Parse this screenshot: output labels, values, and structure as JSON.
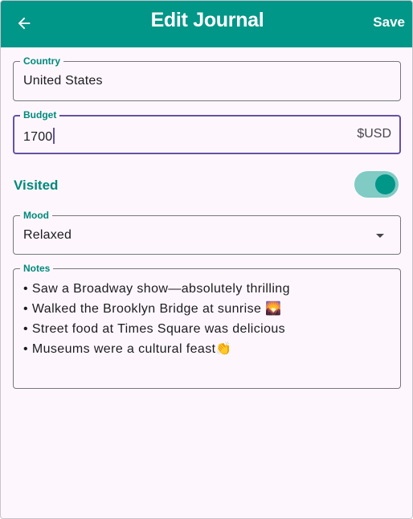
{
  "appbar": {
    "title": "Edit Journal",
    "save_label": "Save",
    "back_icon": "arrow-left-icon",
    "color": "#009688"
  },
  "form": {
    "country": {
      "label": "Country",
      "value": "United States"
    },
    "budget": {
      "label": "Budget",
      "value": "1700",
      "suffix": "$USD"
    },
    "visited": {
      "label": "Visited",
      "checked": true
    },
    "mood": {
      "label": "Mood",
      "value": "Relaxed",
      "icon": "dropdown-arrow-icon"
    },
    "notes": {
      "label": "Notes",
      "lines": [
        "Saw a Broadway show—absolutely thrilling",
        "Walked the Brooklyn Bridge at sunrise 🌄",
        "Street food at Times Square was delicious",
        "Museums were a cultural feast👏"
      ]
    }
  },
  "colors": {
    "accent": "#00897b",
    "focus": "#6750a4",
    "background": "#fdf7fd"
  }
}
